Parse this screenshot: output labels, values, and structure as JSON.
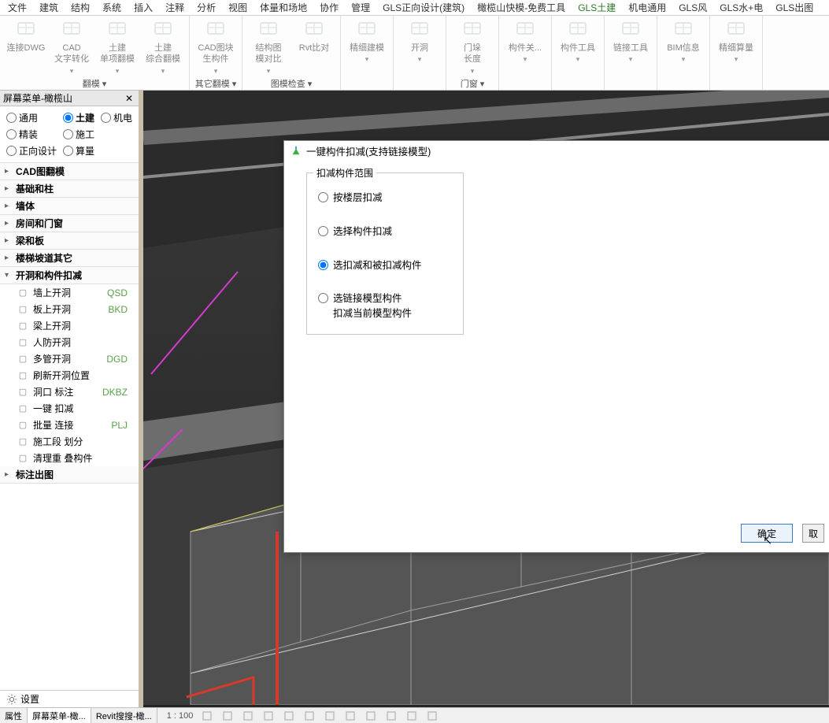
{
  "menu": {
    "tabs": [
      "文件",
      "建筑",
      "结构",
      "系统",
      "插入",
      "注释",
      "分析",
      "视图",
      "体量和场地",
      "协作",
      "管理",
      "GLS正向设计(建筑)",
      "橄榄山快模-免费工具",
      "GLS土建",
      "机电通用",
      "GLS风",
      "GLS水+电",
      "GLS出图"
    ],
    "active_index": 13
  },
  "ribbon": {
    "groups": [
      {
        "name": "翻模",
        "items": [
          {
            "label": "连接DWG",
            "icon": "cad",
            "dd": false
          },
          {
            "label": "CAD\n文字转化",
            "icon": "rvt",
            "dd": true
          },
          {
            "label": "土建\n单项翻模",
            "icon": "dwg",
            "dd": true
          },
          {
            "label": "土建\n综合翻模",
            "icon": "dwg",
            "dd": true
          }
        ]
      },
      {
        "name": "其它翻模",
        "items": [
          {
            "label": "CAD图块\n生构件",
            "icon": "blocks",
            "dd": true
          }
        ]
      },
      {
        "name": "图模检查",
        "items": [
          {
            "label": "结构图\n模对比",
            "icon": "compare",
            "dd": true
          },
          {
            "label": "Rvt比对",
            "icon": "rvtcmp",
            "dd": false
          }
        ]
      },
      {
        "name": "",
        "items": [
          {
            "label": "精细建模",
            "icon": "model",
            "dd": true
          }
        ]
      },
      {
        "name": "",
        "items": [
          {
            "label": "开洞",
            "icon": "opening",
            "dd": true
          }
        ]
      },
      {
        "name": "门窗",
        "items": [
          {
            "label": "门垛\n长度",
            "icon": "door",
            "dd": true
          }
        ]
      },
      {
        "name": "",
        "items": [
          {
            "label": "构件关...",
            "icon": "relate",
            "dd": true
          }
        ]
      },
      {
        "name": "",
        "items": [
          {
            "label": "构件工具",
            "icon": "tools",
            "dd": true
          }
        ]
      },
      {
        "name": "",
        "items": [
          {
            "label": "链接工具",
            "icon": "rvtlink",
            "dd": true
          }
        ]
      },
      {
        "name": "",
        "items": [
          {
            "label": "BIM信息",
            "icon": "info",
            "dd": true
          }
        ]
      },
      {
        "name": "",
        "items": [
          {
            "label": "精细算量",
            "icon": "qty",
            "dd": true
          }
        ]
      }
    ]
  },
  "leftpanel": {
    "title": "屏幕菜单-橄榄山",
    "filters": [
      {
        "label": "通用",
        "checked": false
      },
      {
        "label": "土建",
        "checked": true
      },
      {
        "label": "机电",
        "checked": false
      },
      {
        "label": "精装",
        "checked": false
      },
      {
        "label": "施工",
        "checked": false
      },
      {
        "label": "",
        "checked": null
      },
      {
        "label": "正向设计",
        "checked": false
      },
      {
        "label": "算量",
        "checked": false
      }
    ],
    "sections": [
      {
        "title": "CAD图翻模",
        "expanded": false
      },
      {
        "title": "基础和柱",
        "expanded": false
      },
      {
        "title": "墙体",
        "expanded": false
      },
      {
        "title": "房间和门窗",
        "expanded": false
      },
      {
        "title": "梁和板",
        "expanded": false
      },
      {
        "title": "楼梯坡道其它",
        "expanded": false
      },
      {
        "title": "开洞和构件扣减",
        "expanded": true,
        "active": true,
        "items": [
          {
            "name": "墙上开洞",
            "short": "QSD"
          },
          {
            "name": "板上开洞",
            "short": "BKD"
          },
          {
            "name": "梁上开洞",
            "short": ""
          },
          {
            "name": "人防开洞",
            "short": ""
          },
          {
            "name": "多管开洞",
            "short": "DGD"
          },
          {
            "name": "刷新开洞位置",
            "short": ""
          },
          {
            "name": "洞口 标注",
            "short": "DKBZ"
          },
          {
            "name": "一键 扣减",
            "short": ""
          },
          {
            "name": "批量 连接",
            "short": "PLJ"
          },
          {
            "name": "施工段 划分",
            "short": ""
          },
          {
            "name": "清理重 叠构件",
            "short": ""
          }
        ]
      },
      {
        "title": "标注出图",
        "expanded": false
      }
    ],
    "settings": "设置"
  },
  "dialog": {
    "title": "一键构件扣减(支持链接模型)",
    "group_title": "扣减构件范围",
    "options": [
      {
        "label": "按楼层扣减"
      },
      {
        "label": "选择构件扣减"
      },
      {
        "label": "选扣减和被扣减构件"
      },
      {
        "label": "选链接模型构件\n扣减当前模型构件"
      }
    ],
    "selected_index": 2,
    "ok": "确定",
    "cancel": "取"
  },
  "bottom": {
    "tabs": [
      "属性",
      "屏幕菜单-橄...",
      "Revit搜搜-橄..."
    ],
    "active_index": 1,
    "scale": "1 : 100"
  }
}
